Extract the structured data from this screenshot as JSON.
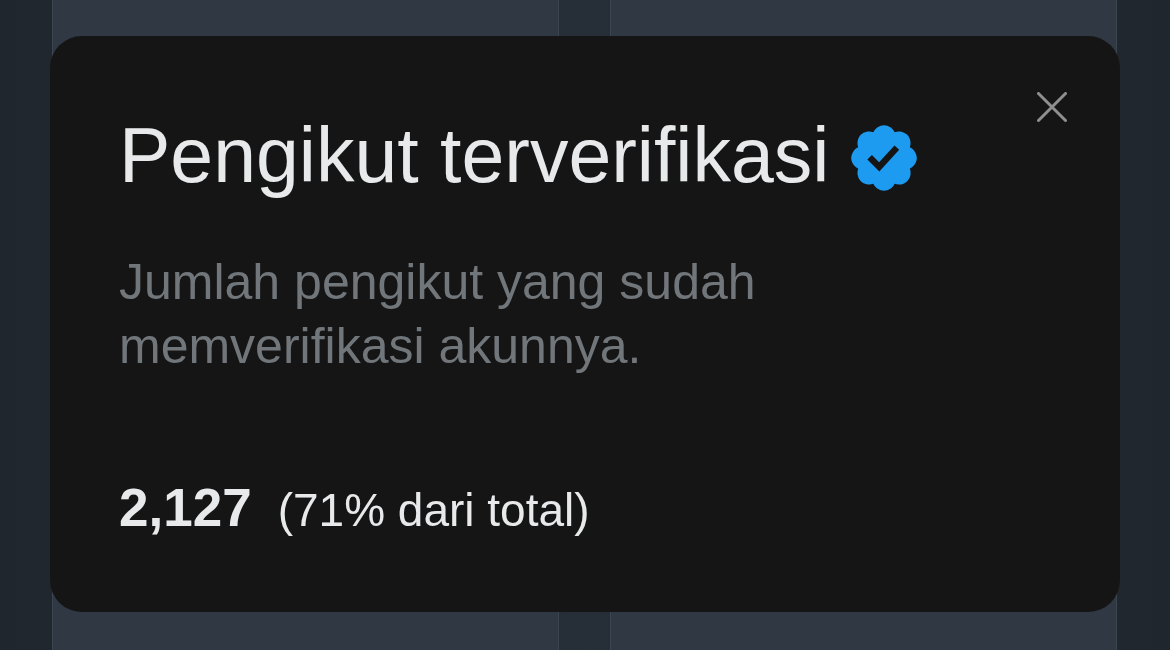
{
  "modal": {
    "title": "Pengikut terverifikasi",
    "verified": true,
    "description": "Jumlah pengikut yang sudah memverifikasi akunnya.",
    "count": "2,127",
    "share": "(71% dari total)"
  }
}
